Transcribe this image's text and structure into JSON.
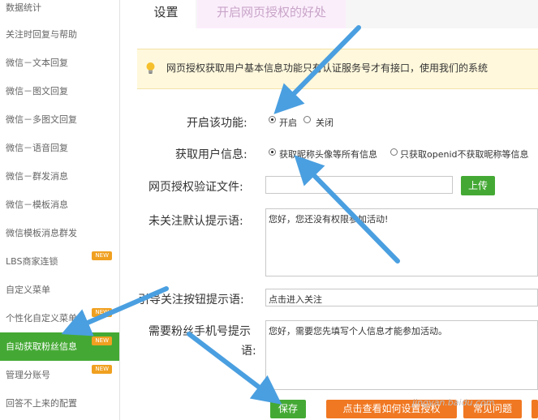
{
  "sidebar": {
    "items": [
      {
        "label": "数据统计",
        "badge": ""
      },
      {
        "label": "关注时回复与帮助",
        "badge": ""
      },
      {
        "label": "微信－文本回复",
        "badge": ""
      },
      {
        "label": "微信－图文回复",
        "badge": ""
      },
      {
        "label": "微信－多图文回复",
        "badge": ""
      },
      {
        "label": "微信－语音回复",
        "badge": ""
      },
      {
        "label": "微信－群发消息",
        "badge": ""
      },
      {
        "label": "微信－模板消息",
        "badge": ""
      },
      {
        "label": "微信模板消息群发",
        "badge": ""
      },
      {
        "label": "LBS商家连锁",
        "badge": "NEW"
      },
      {
        "label": "自定义菜单",
        "badge": ""
      },
      {
        "label": "个性化自定义菜单",
        "badge": "NEW"
      },
      {
        "label": "自动获取粉丝信息",
        "badge": "NEW"
      },
      {
        "label": "管理分账号",
        "badge": "NEW"
      },
      {
        "label": "回答不上来的配置",
        "badge": ""
      }
    ],
    "active_index": 12
  },
  "tabs": {
    "settings": "设置",
    "benefit": "开启网页授权的好处"
  },
  "notice": {
    "text": "网页授权获取用户基本信息功能只有认证服务号才有接口，使用我们的系统"
  },
  "form": {
    "enable_label": "开启该功能:",
    "enable_on": "开启",
    "enable_off": "关闭",
    "userinfo_label": "获取用户信息:",
    "userinfo_all": "获取昵称头像等所有信息",
    "userinfo_openid": "只获取openid不获取昵称等信息",
    "verify_file_label": "网页授权验证文件:",
    "upload_button": "上传",
    "unfollow_tip_label": "未关注默认提示语:",
    "unfollow_tip_value": "您好，您还没有权限参加活动!",
    "follow_button_label": "引导关注按钮提示语:",
    "follow_button_value": "点击进入关注",
    "phone_tip_label_line1": "需要粉丝手机号提示",
    "phone_tip_label_line2": "语:",
    "phone_tip_value": "您好，需要您先填写个人信息才能参加活动。"
  },
  "actions": {
    "save": "保存",
    "howto": "点击查看如何设置授权",
    "faq": "常见问题"
  },
  "watermark": "jingyan.baidu.com",
  "colors": {
    "accent_green": "#44a934",
    "accent_orange": "#f07822",
    "badge_orange": "#f0a020",
    "arrow_blue": "#4a9fe0"
  }
}
